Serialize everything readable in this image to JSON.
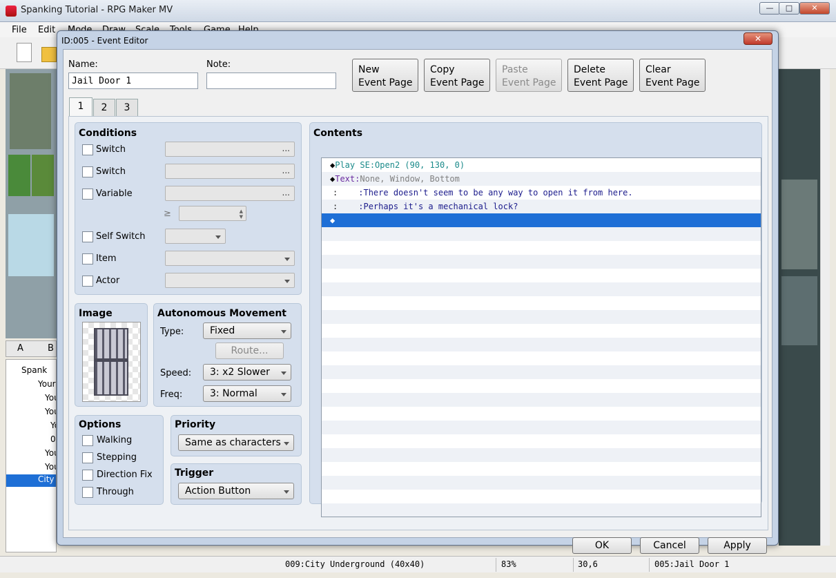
{
  "app": {
    "title": "Spanking Tutorial - RPG Maker MV",
    "menu": [
      "File",
      "Edit",
      "Mode",
      "Draw",
      "Scale",
      "Tools",
      "Game",
      "Help"
    ],
    "tile_tabs": [
      "A",
      "B"
    ],
    "tree": [
      "Spank",
      "Your",
      "You",
      "You",
      "Yo",
      "0",
      "You",
      "You",
      "City"
    ],
    "status": {
      "map": "009:City Underground (40x40)",
      "zoom": "83%",
      "coords": "30,6",
      "event": "005:Jail Door 1"
    }
  },
  "dialog": {
    "title": "ID:005 - Event Editor",
    "name_label": "Name:",
    "name_value": "Jail Door 1",
    "note_label": "Note:",
    "note_value": "",
    "page_buttons": [
      {
        "line1": "New",
        "line2": "Event Page"
      },
      {
        "line1": "Copy",
        "line2": "Event Page"
      },
      {
        "line1": "Paste",
        "line2": "Event Page"
      },
      {
        "line1": "Delete",
        "line2": "Event Page"
      },
      {
        "line1": "Clear",
        "line2": "Event Page"
      }
    ],
    "tabs": [
      "1",
      "2",
      "3"
    ],
    "conditions": {
      "title": "Conditions",
      "items": [
        "Switch",
        "Switch",
        "Variable",
        "Self Switch",
        "Item",
        "Actor"
      ],
      "ge": "≥",
      "dots": "..."
    },
    "image": {
      "title": "Image"
    },
    "movement": {
      "title": "Autonomous Movement",
      "type_label": "Type:",
      "type_value": "Fixed",
      "route_label": "Route...",
      "speed_label": "Speed:",
      "speed_value": "3: x2 Slower",
      "freq_label": "Freq:",
      "freq_value": "3: Normal"
    },
    "options": {
      "title": "Options",
      "items": [
        "Walking",
        "Stepping",
        "Direction Fix",
        "Through"
      ]
    },
    "priority": {
      "title": "Priority",
      "value": "Same as characters"
    },
    "trigger": {
      "title": "Trigger",
      "value": "Action Button"
    },
    "contents": {
      "title": "Contents",
      "lines": [
        {
          "cmd": "Play SE",
          "sep": ":",
          "args": "Open2 (90, 130, 0)"
        },
        {
          "cmd": "Text",
          "sep": ":",
          "args": "None, Window, Bottom"
        },
        {
          "cmd": ":",
          "sep": ":",
          "args": "There doesn't seem to be any way to open it from here."
        },
        {
          "cmd": ":",
          "sep": ":",
          "args": "Perhaps it's a mechanical lock?"
        }
      ]
    },
    "footer": {
      "ok": "OK",
      "cancel": "Cancel",
      "apply": "Apply"
    }
  },
  "colors": {
    "selection": "#1e6fd6",
    "play_se": "#1a8a8a",
    "text_cmd": "#6a2aa0",
    "text_args": "#808080",
    "message": "#1c1c8c"
  }
}
